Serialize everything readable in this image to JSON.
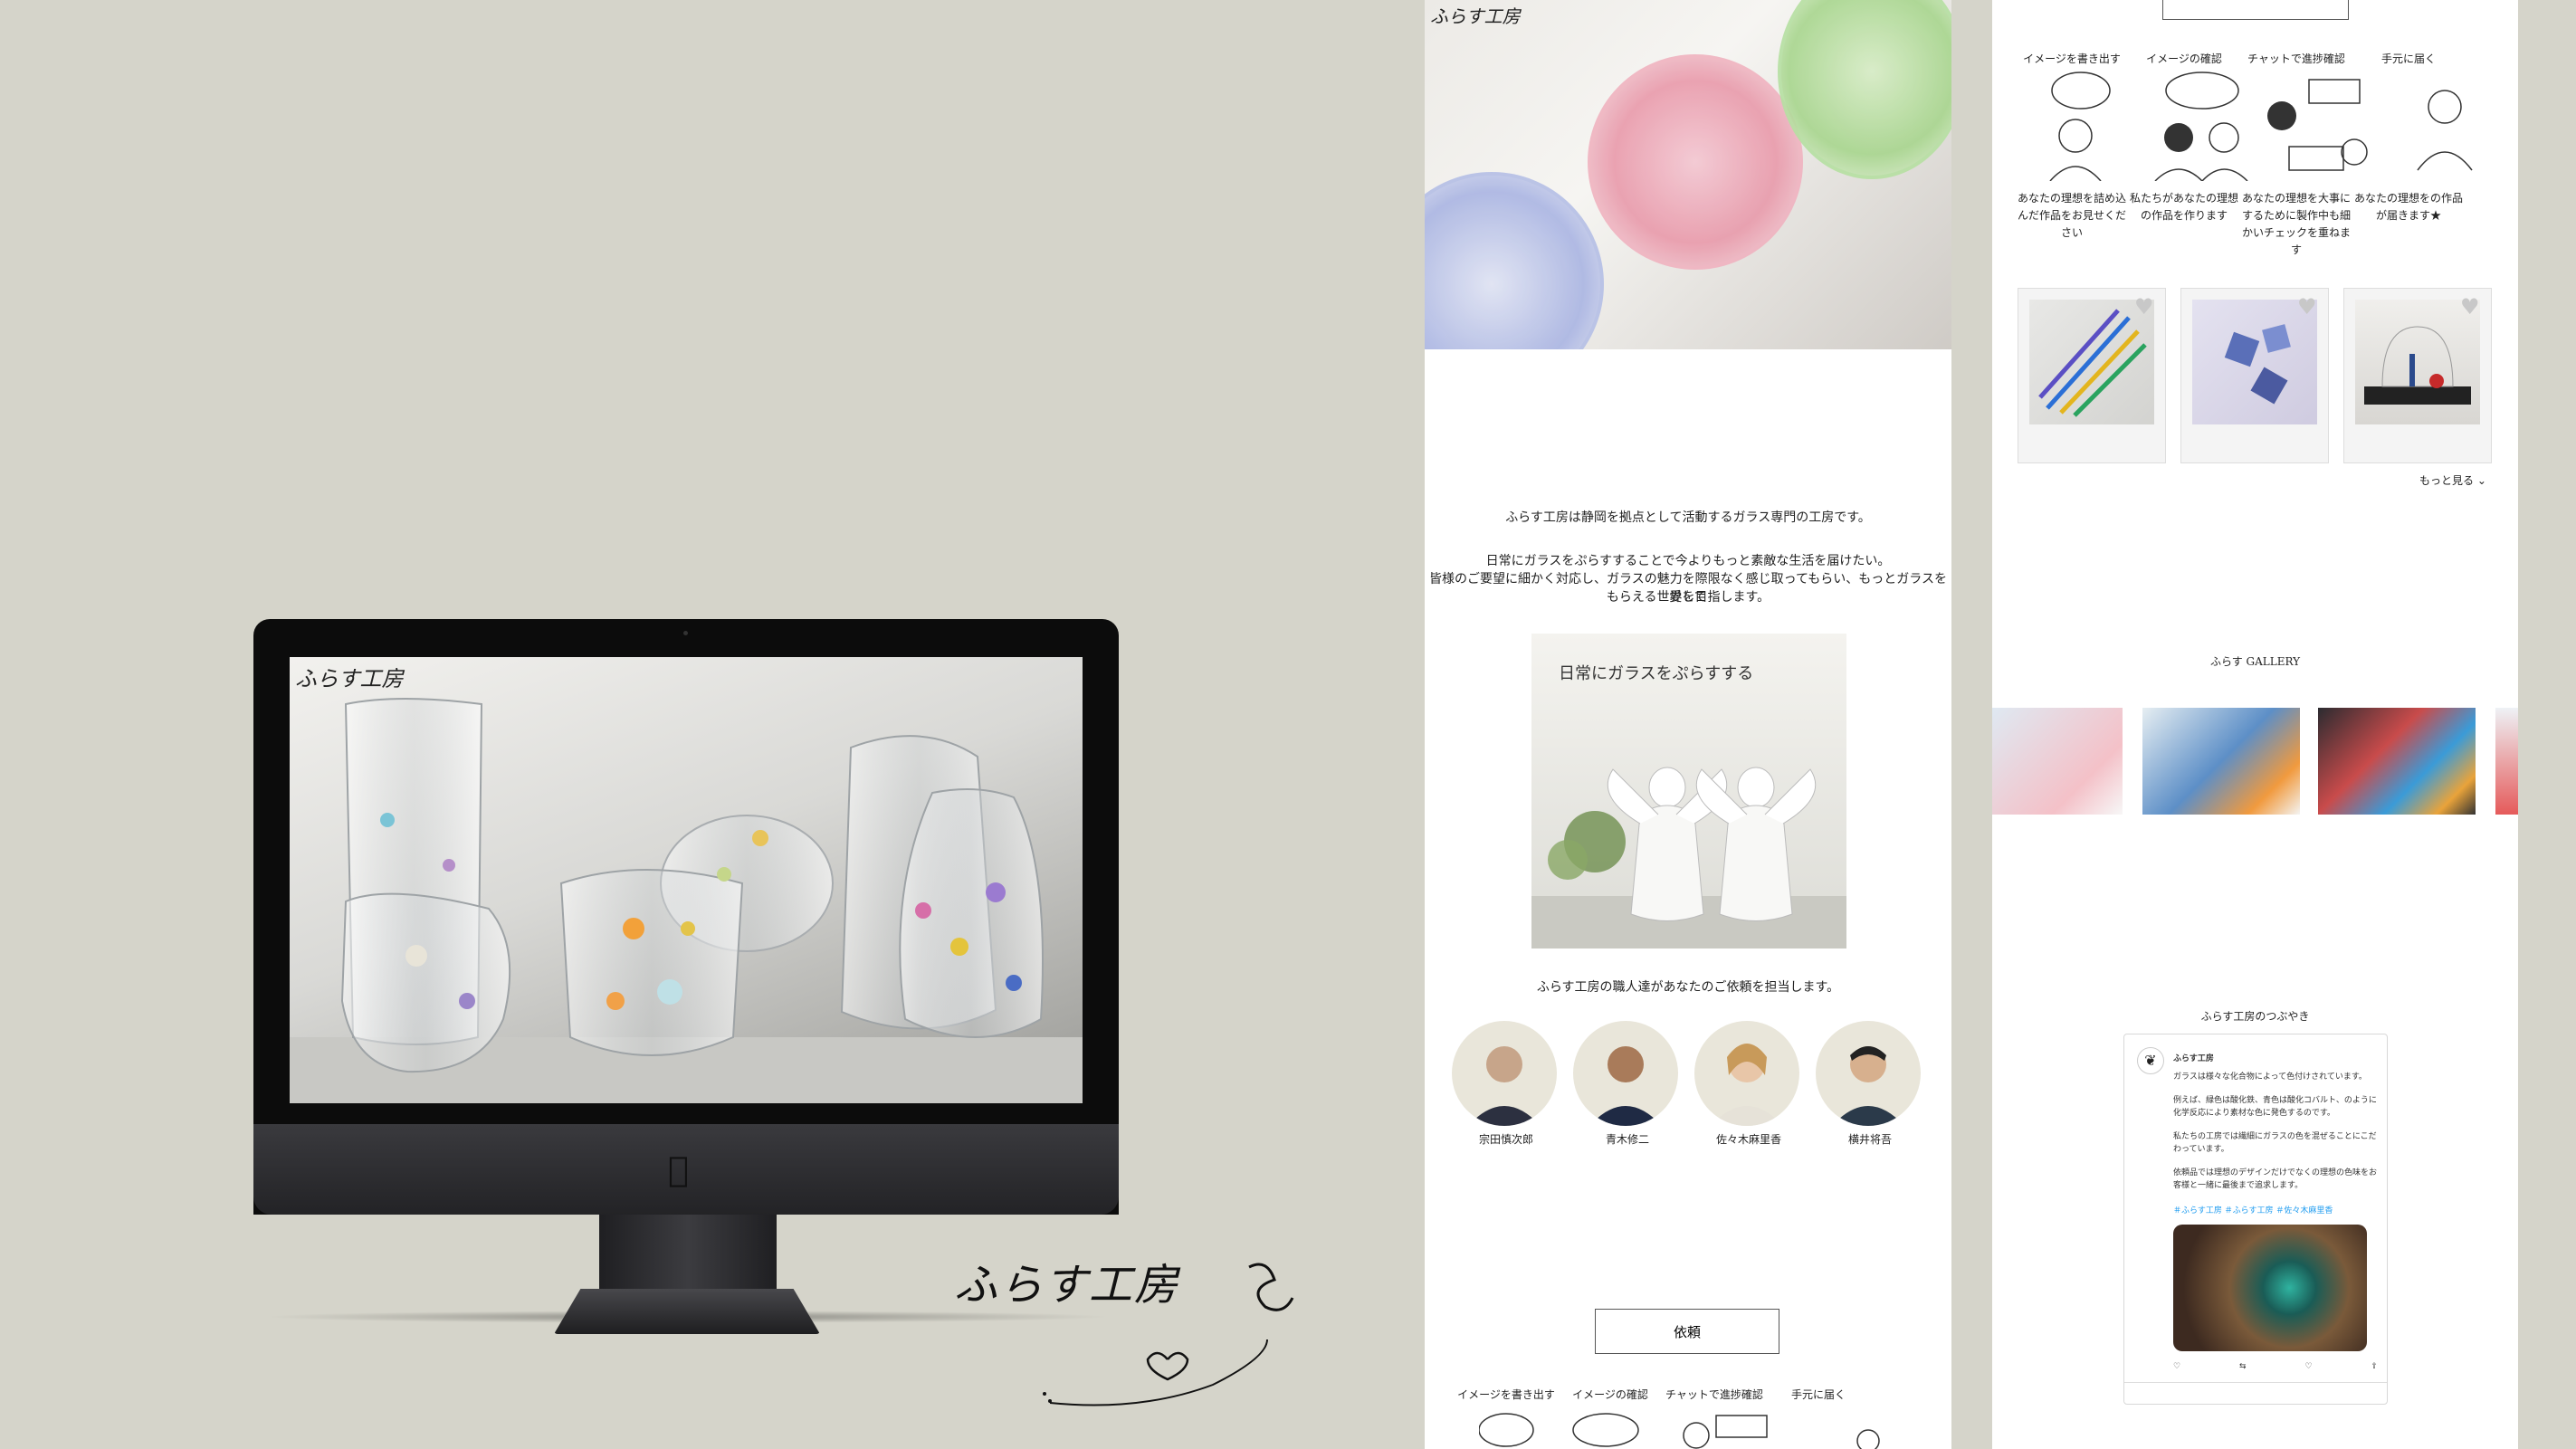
{
  "brand": {
    "logo_text": "ふらす工房",
    "accent": "#d5d4ca"
  },
  "panel1": {
    "intro_lines": [
      "ふらす工房は静岡を拠点として活動するガラス専門の工房です。",
      "日常にガラスをぷらすすることで今よりもっと素敵な生活を届けたい。",
      "皆様のご要望に細かく対応し、ガラスの魅力を際限なく感じ取ってもらい、もっとガラスを愛して",
      "もらえる世界を目指します。"
    ],
    "feature_caption": "日常にガラスをぷらすする",
    "artisans_heading": "ふらす工房の職人達があなたのご依頼を担当します。",
    "artisans": [
      {
        "name": "宗田慎次郎",
        "icon": "artisan-portrait-icon"
      },
      {
        "name": "青木修二",
        "icon": "artisan-portrait-icon"
      },
      {
        "name": "佐々木麻里香",
        "icon": "artisan-portrait-icon"
      },
      {
        "name": "横井将吾",
        "icon": "artisan-portrait-icon"
      }
    ],
    "request_button": "依頼",
    "steps": [
      "イメージを書き出す",
      "イメージの確認",
      "チャットで進捗確認",
      "手元に届く"
    ]
  },
  "panel2": {
    "steps": [
      {
        "title": "イメージを書き出す",
        "desc": "あなたの理想を詰め込んだ作品をお見せください"
      },
      {
        "title": "イメージの確認",
        "desc": "私たちがあなたの理想の作品を作ります"
      },
      {
        "title": "チャットで進捗確認",
        "desc": "あなたの理想を大事にするために製作中も細かいチェックを重ねます"
      },
      {
        "title": "手元に届く",
        "desc": "あなたの理想をの作品が届きます★"
      }
    ],
    "more_link": "もっと見る ⌄",
    "gallery_heading": "ふらす GALLERY",
    "tweets_heading": "ふらす工房のつぶやき",
    "tweet": {
      "author": "ふらす工房",
      "paragraphs": [
        "ガラスは様々な化合物によって色付けされています。",
        "例えば、緑色は酸化鉄、青色は酸化コバルト、のように化学反応により素材な色に発色するのです。",
        "私たちの工房では繊細にガラスの色を混ぜることにこだわっています。",
        "依頼品では理想のデザインだけでなくの理想の色味をお客様と一緒に最後まで追求します。"
      ],
      "hashtags": "＃ふらす工房 ＃ふらす工房 ＃佐々木麻里香",
      "actions": [
        "♡",
        "⇆",
        "♡",
        "⇪"
      ]
    }
  },
  "signature": {
    "text": "ふらす工房"
  }
}
